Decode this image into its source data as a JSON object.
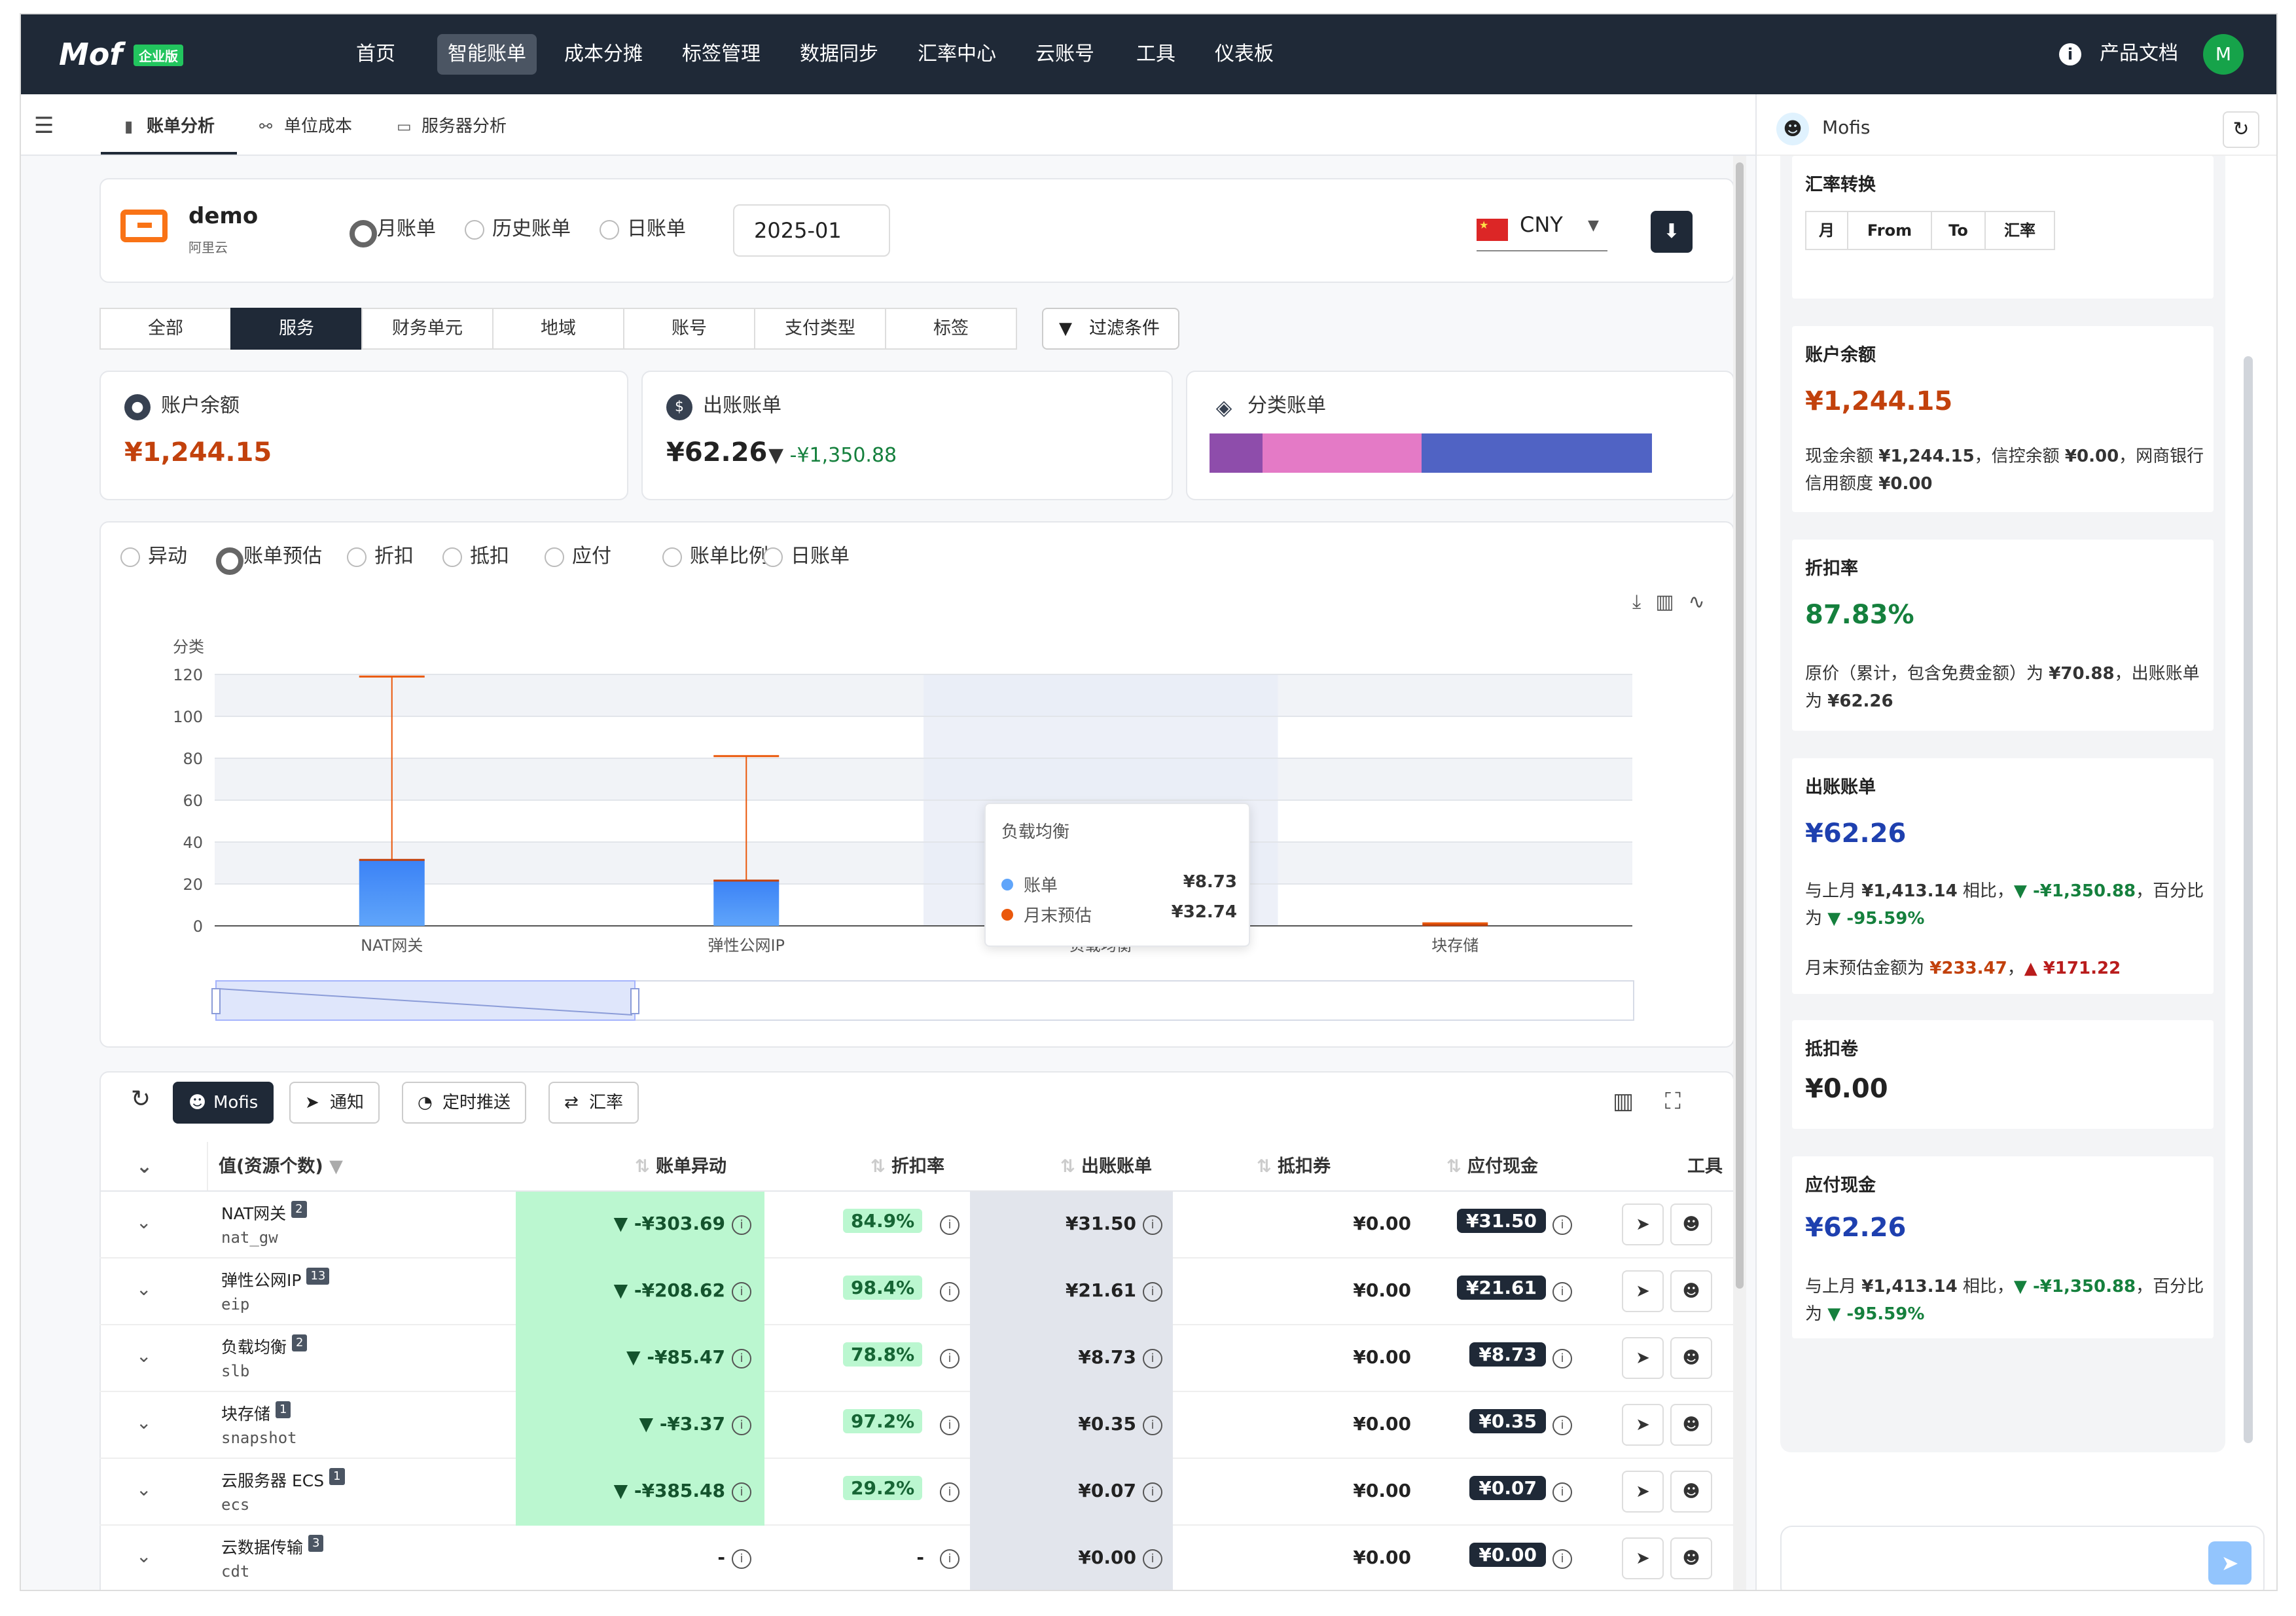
{
  "nav": {
    "logo": "Mof",
    "edition": "企业版",
    "items": [
      "首页",
      "智能账单",
      "成本分摊",
      "标签管理",
      "数据同步",
      "汇率中心",
      "云账号",
      "工具",
      "仪表板"
    ],
    "active": "智能账单",
    "docs": "产品文档",
    "avatar": "M"
  },
  "subtabs": [
    {
      "label": "账单分析",
      "icon": "bar-chart-icon",
      "active": true
    },
    {
      "label": "单位成本",
      "icon": "link-icon",
      "active": false
    },
    {
      "label": "服务器分析",
      "icon": "server-icon",
      "active": false
    }
  ],
  "account": {
    "name": "demo",
    "provider": "阿里云"
  },
  "bill_modes": [
    "月账单",
    "历史账单",
    "日账单"
  ],
  "bill_mode_selected": "月账单",
  "month": "2025-01",
  "currency": "CNY",
  "dimension_tabs": [
    "全部",
    "服务",
    "财务单元",
    "地域",
    "账号",
    "支付类型",
    "标签"
  ],
  "dimension_active": "服务",
  "filter_label": "过滤条件",
  "stats": {
    "balance": {
      "title": "账户余额",
      "value": "¥1,244.15"
    },
    "bill": {
      "title": "出账账单",
      "value": "¥62.26",
      "delta": "-¥1,350.88"
    },
    "category": {
      "title": "分类账单",
      "segments": [
        {
          "color": "#8e4dab",
          "fraction": 0.12
        },
        {
          "color": "#e47ac6",
          "fraction": 0.36
        },
        {
          "color": "#5063c4",
          "fraction": 0.52
        }
      ]
    }
  },
  "chart_options": [
    "异动",
    "账单预估",
    "折扣",
    "抵扣",
    "应付",
    "账单比例",
    "日账单"
  ],
  "chart_option_selected": "账单预估",
  "chart_data": {
    "type": "bar",
    "ylabel": "分类",
    "ylim": [
      0,
      120
    ],
    "yticks": [
      0,
      20,
      40,
      60,
      80,
      100,
      120
    ],
    "categories": [
      "NAT网关",
      "弹性公网IP",
      "负载均衡",
      "块存储"
    ],
    "series": [
      {
        "name": "账单",
        "values": [
          31.5,
          21.61,
          8.73,
          0.35
        ]
      },
      {
        "name": "月末预估",
        "values": [
          119,
          81,
          32.74,
          1.2
        ]
      }
    ],
    "highlight_category": "负载均衡"
  },
  "tooltip": {
    "title": "负载均衡",
    "rows": [
      {
        "label": "账单",
        "value": "¥8.73",
        "color": "#60a5fa"
      },
      {
        "label": "月末预估",
        "value": "¥32.74",
        "color": "#ea580c"
      }
    ]
  },
  "table_toolbar": {
    "mofis": "Mofis",
    "notify": "通知",
    "schedule": "定时推送",
    "fx": "汇率"
  },
  "table_headers": [
    "值(资源个数)",
    "账单异动",
    "折扣率",
    "出账账单",
    "抵扣券",
    "应付现金",
    "工具"
  ],
  "rows": [
    {
      "name": "NAT网关",
      "count": "2",
      "code": "nat_gw",
      "change": "-¥303.69",
      "discount": "84.9%",
      "bill": "¥31.50",
      "coupon": "¥0.00",
      "cash": "¥31.50"
    },
    {
      "name": "弹性公网IP",
      "count": "13",
      "code": "eip",
      "change": "-¥208.62",
      "discount": "98.4%",
      "bill": "¥21.61",
      "coupon": "¥0.00",
      "cash": "¥21.61"
    },
    {
      "name": "负载均衡",
      "count": "2",
      "code": "slb",
      "change": "-¥85.47",
      "discount": "78.8%",
      "bill": "¥8.73",
      "coupon": "¥0.00",
      "cash": "¥8.73"
    },
    {
      "name": "块存储",
      "count": "1",
      "code": "snapshot",
      "change": "-¥3.37",
      "discount": "97.2%",
      "bill": "¥0.35",
      "coupon": "¥0.00",
      "cash": "¥0.35"
    },
    {
      "name": "云服务器 ECS",
      "count": "1",
      "code": "ecs",
      "change": "-¥385.48",
      "discount": "29.2%",
      "bill": "¥0.07",
      "coupon": "¥0.00",
      "cash": "¥0.07"
    },
    {
      "name": "云数据传输",
      "count": "3",
      "code": "cdt",
      "change": "-",
      "discount": "-",
      "bill": "¥0.00",
      "coupon": "¥0.00",
      "cash": "¥0.00"
    }
  ],
  "panel": {
    "title": "Mofis",
    "fx": {
      "title": "汇率转换",
      "cols": [
        "月",
        "From",
        "To",
        "汇率"
      ]
    },
    "balance": {
      "title": "账户余额",
      "value": "¥1,244.15",
      "t1": "现金余额 ",
      "v1": "¥1,244.15",
      "t2": "，信控余额 ",
      "v2": "¥0.00",
      "t3": "，网商银行信用额度 ",
      "v3": "¥0.00"
    },
    "discount": {
      "title": "折扣率",
      "value": "87.83%",
      "t1": "原价（累计，包含免费金额）为 ",
      "v1": "¥70.88",
      "t2": "，出账账单为 ",
      "v2": "¥62.26"
    },
    "bill": {
      "title": "出账账单",
      "value": "¥62.26",
      "t1": "与上月 ",
      "v1": "¥1,413.14",
      "t2": " 相比，",
      "v2": "▼ -¥1,350.88",
      "t3": "，百分比为 ",
      "v3": "▼ -95.59%",
      "t4": "月末预估金额为 ",
      "v4": "¥233.47",
      "t5": "，",
      "v5": "▲ ¥171.22"
    },
    "coupon": {
      "title": "抵扣卷",
      "value": "¥0.00"
    },
    "cash": {
      "title": "应付现金",
      "value": "¥62.26",
      "t1": "与上月 ",
      "v1": "¥1,413.14",
      "t2": " 相比，",
      "v2": "▼ -¥1,350.88",
      "t3": "，百分比为 ",
      "v3": "▼ -95.59%"
    }
  }
}
